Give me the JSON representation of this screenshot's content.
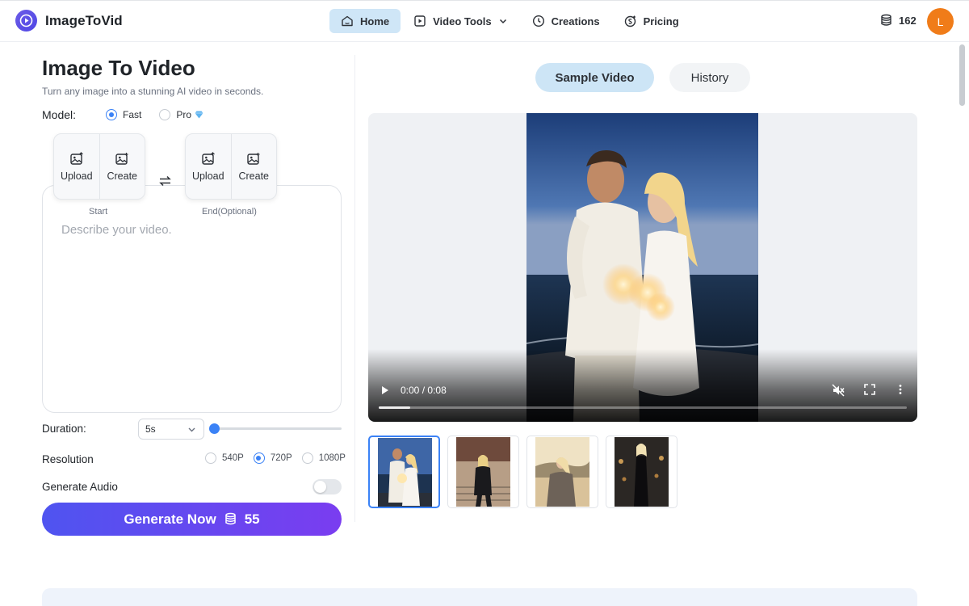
{
  "app": {
    "name": "ImageToVid",
    "user_initial": "L",
    "credits": "162"
  },
  "nav": {
    "items": [
      {
        "label": "Home",
        "icon": "home-icon",
        "active": true
      },
      {
        "label": "Video Tools",
        "icon": "video-tools-icon",
        "has_dropdown": true
      },
      {
        "label": "Creations",
        "icon": "clock-icon"
      },
      {
        "label": "Pricing",
        "icon": "coin-icon"
      }
    ]
  },
  "page": {
    "title": "Image To Video",
    "subtitle": "Turn any image into a stunning AI video in seconds."
  },
  "model": {
    "label": "Model:",
    "options": [
      {
        "label": "Fast",
        "selected": true
      },
      {
        "label": "Pro",
        "selected": false,
        "badge": "diamond-icon"
      }
    ]
  },
  "frames": {
    "start": {
      "upload": "Upload",
      "create": "Create",
      "caption": "Start"
    },
    "end": {
      "upload": "Upload",
      "create": "Create",
      "caption": "End(Optional)"
    }
  },
  "prompt": {
    "placeholder": "Describe your video."
  },
  "duration": {
    "label": "Duration:",
    "value": "5s",
    "slider_fraction": 0
  },
  "resolution": {
    "label": "Resolution",
    "options": [
      {
        "label": "540P",
        "selected": false
      },
      {
        "label": "720P",
        "selected": true
      },
      {
        "label": "1080P",
        "selected": false
      }
    ]
  },
  "audio": {
    "label": "Generate Audio",
    "enabled": false
  },
  "generate": {
    "label": "Generate Now",
    "cost": "55"
  },
  "tabs": [
    {
      "label": "Sample Video",
      "active": true
    },
    {
      "label": "History",
      "active": false
    }
  ],
  "player": {
    "current": "0:00",
    "separator": "/",
    "duration": "0:08",
    "progress": 0.06
  },
  "samples": [
    {
      "name": "beach-couple-sparklers",
      "selected": true
    },
    {
      "name": "woman-city-steps",
      "selected": false
    },
    {
      "name": "woman-mountain-sunset",
      "selected": false
    },
    {
      "name": "woman-night-street",
      "selected": false
    }
  ],
  "colors": {
    "accent": "#3b82f6",
    "active_nav": "#cfe6f7",
    "button_start": "#4f54f0",
    "button_end": "#7a3df0",
    "avatar": "#f07c19"
  }
}
